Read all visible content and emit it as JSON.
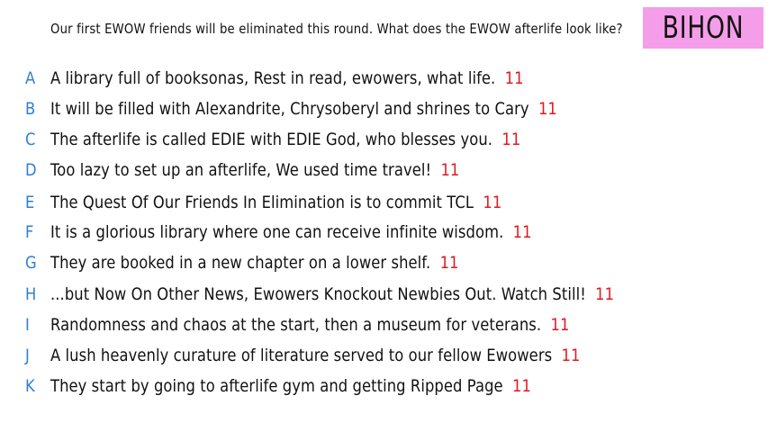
{
  "prompt": "Our first EWOW friends will be eliminated this round. What does the EWOW afterlife look like?",
  "badge": "BIHON",
  "colors": {
    "badge_bg": "#f49de8",
    "letter": "#2f7fd6",
    "score": "#e0191f"
  },
  "entries": [
    {
      "letter": "A",
      "text": "A library full of booksonas, Rest in read, ewowers, what life.",
      "score": "11"
    },
    {
      "letter": "B",
      "text": "It will be filled with Alexandrite, Chrysoberyl and shrines to Cary",
      "score": "11"
    },
    {
      "letter": "C",
      "text": "The afterlife is called EDIE with EDIE God, who blesses you.",
      "score": "11"
    },
    {
      "letter": "D",
      "text": "Too lazy to set up an afterlife, We used time travel!",
      "score": "11"
    },
    {
      "letter": "E",
      "text": "The Quest Of Our Friends In Elimination is to commit TCL",
      "score": "11"
    },
    {
      "letter": "F",
      "text": "It is a glorious library where one can receive infinite wisdom.",
      "score": "11"
    },
    {
      "letter": "G",
      "text": "They are booked in a new chapter on a lower shelf.",
      "score": "11"
    },
    {
      "letter": "H",
      "text": "...but Now On Other News, Ewowers Knockout Newbies Out. Watch Still!",
      "score": "11"
    },
    {
      "letter": "I",
      "text": "Randomness and chaos at the start, then a museum for veterans.",
      "score": "11"
    },
    {
      "letter": "J",
      "text": "A lush heavenly curature of literature served to our fellow Ewowers",
      "score": "11"
    },
    {
      "letter": "K",
      "text": "They start by going to afterlife gym and getting Ripped Page",
      "score": "11"
    }
  ]
}
